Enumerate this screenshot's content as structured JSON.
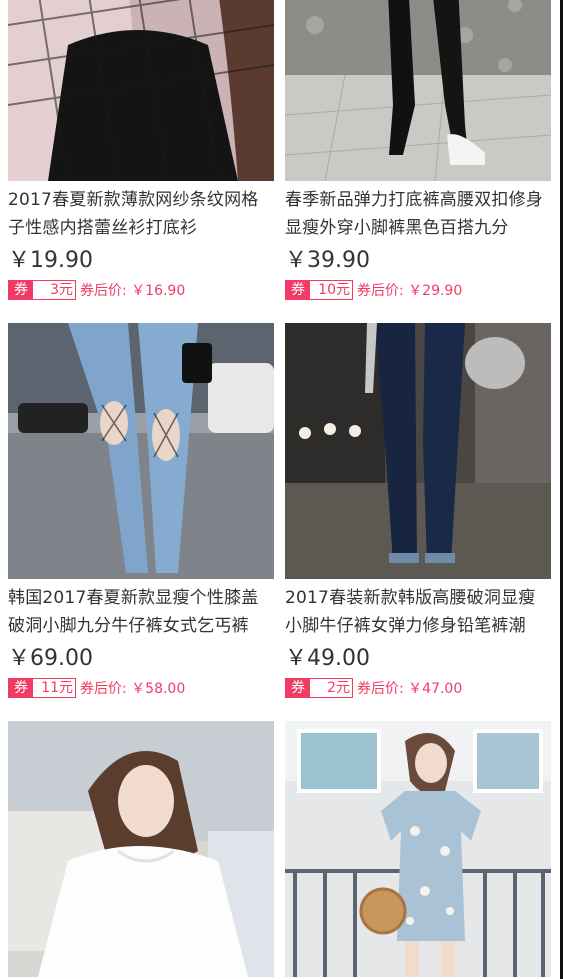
{
  "products": [
    {
      "title": "2017春夏新款薄款网纱条纹网格子性感内搭蕾丝衫打底衫",
      "price": "￥19.90",
      "coupon_tag": "券",
      "coupon_amount": "3元",
      "after_label": "券后价: ￥16.90",
      "image": "black-top-fishnet-photo"
    },
    {
      "title": "春季新品弹力打底裤高腰双扣修身显瘦外穿小脚裤黑色百搭九分",
      "price": "￥39.90",
      "coupon_tag": "券",
      "coupon_amount": "10元",
      "after_label": "券后价: ￥29.90",
      "image": "black-leggings-photo"
    },
    {
      "title": "韩国2017春夏新款显瘦个性膝盖破洞小脚九分牛仔裤女式乞丐裤",
      "price": "￥69.00",
      "coupon_tag": "券",
      "coupon_amount": "11元",
      "after_label": "券后价: ￥58.00",
      "image": "ripped-light-jeans-photo"
    },
    {
      "title": "2017春装新款韩版高腰破洞显瘦小脚牛仔裤女弹力修身铅笔裤潮",
      "price": "￥49.00",
      "coupon_tag": "券",
      "coupon_amount": "2元",
      "after_label": "券后价: ￥47.00",
      "image": "dark-skinny-jeans-photo"
    },
    {
      "title": "",
      "price": "",
      "coupon_tag": "",
      "coupon_amount": "",
      "after_label": "",
      "image": "white-tshirt-photo"
    },
    {
      "title": "",
      "price": "",
      "coupon_tag": "",
      "coupon_amount": "",
      "after_label": "",
      "image": "floral-romper-photo"
    }
  ],
  "colors": {
    "accent": "#f23b64",
    "text": "#333333"
  }
}
